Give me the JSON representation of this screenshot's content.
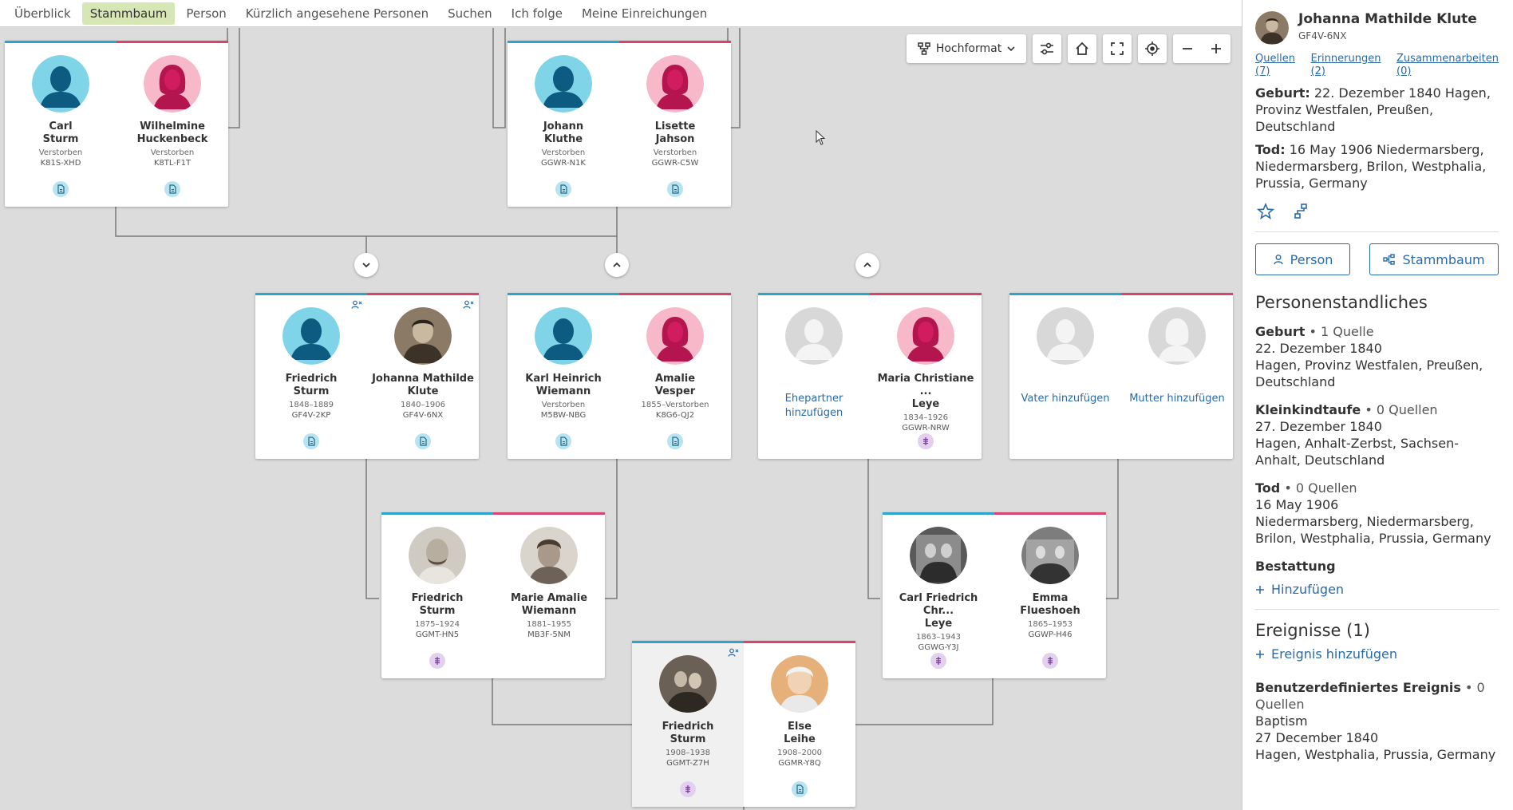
{
  "nav": [
    "Überblick",
    "Stammbaum",
    "Person",
    "Kürzlich angesehene Personen",
    "Suchen",
    "Ich folge",
    "Meine Einreichungen"
  ],
  "toolbar": {
    "layout_label": "Hochformat"
  },
  "cards": {
    "c1": {
      "left": {
        "name1": "Carl",
        "name2": "Sturm",
        "dates": "Verstorben",
        "id": "K81S-XHD"
      },
      "right": {
        "name1": "Wilhelmine",
        "name2": "Huckenbeck",
        "dates": "Verstorben",
        "id": "K8TL-F1T"
      }
    },
    "c2": {
      "left": {
        "name1": "Johann",
        "name2": "Kluthe",
        "dates": "Verstorben",
        "id": "GGWR-N1K"
      },
      "right": {
        "name1": "Lisette",
        "name2": "Jahson",
        "dates": "Verstorben",
        "id": "GGWR-C5W"
      }
    },
    "c3": {
      "left": {
        "name1": "Friedrich",
        "name2": "Sturm",
        "dates": "1848–1889",
        "id": "GF4V-2KP"
      },
      "right": {
        "name1": "Johanna Mathilde",
        "name2": "Klute",
        "dates": "1840–1906",
        "id": "GF4V-6NX"
      }
    },
    "c4": {
      "left": {
        "name1": "Karl Heinrich",
        "name2": "Wiemann",
        "dates": "Verstorben",
        "id": "M5BW-NBG"
      },
      "right": {
        "name1": "Amalie",
        "name2": "Vesper",
        "dates": "1855–Verstorben",
        "id": "K8G6-QJ2"
      }
    },
    "c5": {
      "left": {
        "add": "Ehepartner hinzufügen"
      },
      "right": {
        "name1": "Maria Christiane ...",
        "name2": "Leye",
        "dates": "1834–1926",
        "id": "GGWR-NRW"
      }
    },
    "c6": {
      "left": {
        "add": "Vater hinzufügen"
      },
      "right": {
        "add": "Mutter hinzufügen"
      }
    },
    "c7": {
      "left": {
        "name1": "Friedrich",
        "name2": "Sturm",
        "dates": "1875–1924",
        "id": "GGMT-HN5"
      },
      "right": {
        "name1": "Marie Amalie",
        "name2": "Wiemann",
        "dates": "1881–1955",
        "id": "MB3F-5NM"
      }
    },
    "c8": {
      "left": {
        "name1": "Carl Friedrich Chr...",
        "name2": "Leye",
        "dates": "1863–1943",
        "id": "GGWG-Y3J"
      },
      "right": {
        "name1": "Emma",
        "name2": "Flueshoeh",
        "dates": "1865–1953",
        "id": "GGWP-H46"
      }
    },
    "c9": {
      "left": {
        "name1": "Friedrich",
        "name2": "Sturm",
        "dates": "1908–1938",
        "id": "GGMT-Z7H"
      },
      "right": {
        "name1": "Else",
        "name2": "Leihe",
        "dates": "1908–2000",
        "id": "GGMR-Y8Q"
      }
    }
  },
  "panel": {
    "name": "Johanna Mathilde Klute",
    "id": "GF4V-6NX",
    "links": {
      "quellen1": "Quellen",
      "quellen2": "(7)",
      "erinn1": "Erinnerungen",
      "erinn2": "(2)",
      "zus1": "Zusammenarbeiten",
      "zus2": "(0)"
    },
    "birth_label": "Geburt:",
    "birth_text": " 22. Dezember 1840 Hagen, Provinz Westfalen, Preußen, Deutschland",
    "death_label": "Tod:",
    "death_text": " 16 May 1906 Niedermarsberg, Niedermarsberg, Brilon, Westphalia, Prussia, Germany",
    "btn_person": "Person",
    "btn_tree": "Stammbaum",
    "vitals_title": "Personenstandliches",
    "v_birth_h": "Geburt",
    "v_birth_s": " • 1 Quelle",
    "v_birth_d": "22. Dezember 1840",
    "v_birth_p": "Hagen, Provinz Westfalen, Preußen, Deutschland",
    "v_chr_h": "Kleinkindtaufe",
    "v_chr_s": " • 0 Quellen",
    "v_chr_d": "27. Dezember 1840",
    "v_chr_p": "Hagen, Anhalt-Zerbst, Sachsen-Anhalt, Deutschland",
    "v_death_h": "Tod",
    "v_death_s": " • 0 Quellen",
    "v_death_d": "16 May 1906",
    "v_death_p": "Niedermarsberg, Niedermarsberg, Brilon, Westphalia, Prussia, Germany",
    "v_burial_h": "Bestattung",
    "add_label": "Hinzufügen",
    "events_title": "Ereignisse (1)",
    "add_event": "Ereignis hinzufügen",
    "ev_h": "Benutzerdefiniertes Ereignis",
    "ev_s": " • 0 Quellen",
    "ev_type": "Baptism",
    "ev_d": "27 December 1840",
    "ev_p": "Hagen, Westphalia, Prussia, Germany"
  }
}
